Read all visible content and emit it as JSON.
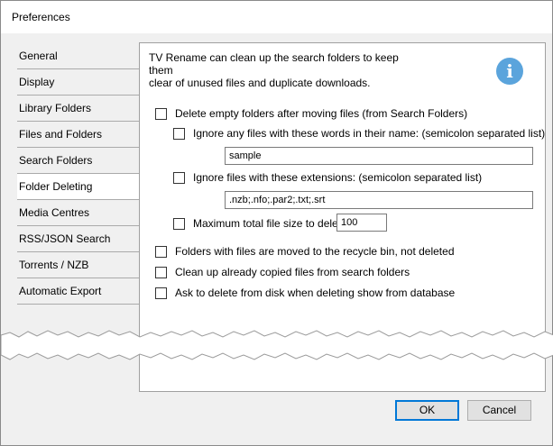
{
  "window": {
    "title": "Preferences"
  },
  "sidebar": {
    "tabs": [
      {
        "label": "General"
      },
      {
        "label": "Display"
      },
      {
        "label": "Library Folders"
      },
      {
        "label": "Files and Folders"
      },
      {
        "label": "Search Folders"
      },
      {
        "label": "Folder Deleting"
      },
      {
        "label": "Media Centres"
      },
      {
        "label": "RSS/JSON Search"
      },
      {
        "label": "Torrents / NZB"
      },
      {
        "label": "Automatic Export"
      }
    ],
    "selected": "Folder Deleting"
  },
  "panel": {
    "intro_line1": "TV Rename can clean up the search folders to keep them",
    "intro_line2": "clear of unused files and duplicate downloads.",
    "info_icon": "info-icon",
    "info_glyph": "i",
    "accent_color": "#5ba4dc",
    "options": {
      "delete_empty": {
        "label": "Delete empty folders after moving files (from Search Folders)",
        "checked": false
      },
      "ignore_words": {
        "label": "Ignore any files with these words in their name: (semicolon separated list)",
        "checked": false,
        "value": "sample"
      },
      "ignore_ext": {
        "label": "Ignore files with these extensions: (semicolon separated list)",
        "checked": false,
        "value": ".nzb;.nfo;.par2;.txt;.srt"
      },
      "max_size": {
        "label": "Maximum total file size to delete:",
        "checked": false,
        "value": "100"
      },
      "recycle": {
        "label": "Folders with files are moved to the recycle bin, not deleted",
        "checked": false
      },
      "cleanup_copied": {
        "label": "Clean up already copied files from search folders",
        "checked": false
      },
      "ask_delete": {
        "label": "Ask to delete from disk when deleting show from database",
        "checked": false
      }
    }
  },
  "buttons": {
    "ok": "OK",
    "cancel": "Cancel"
  }
}
